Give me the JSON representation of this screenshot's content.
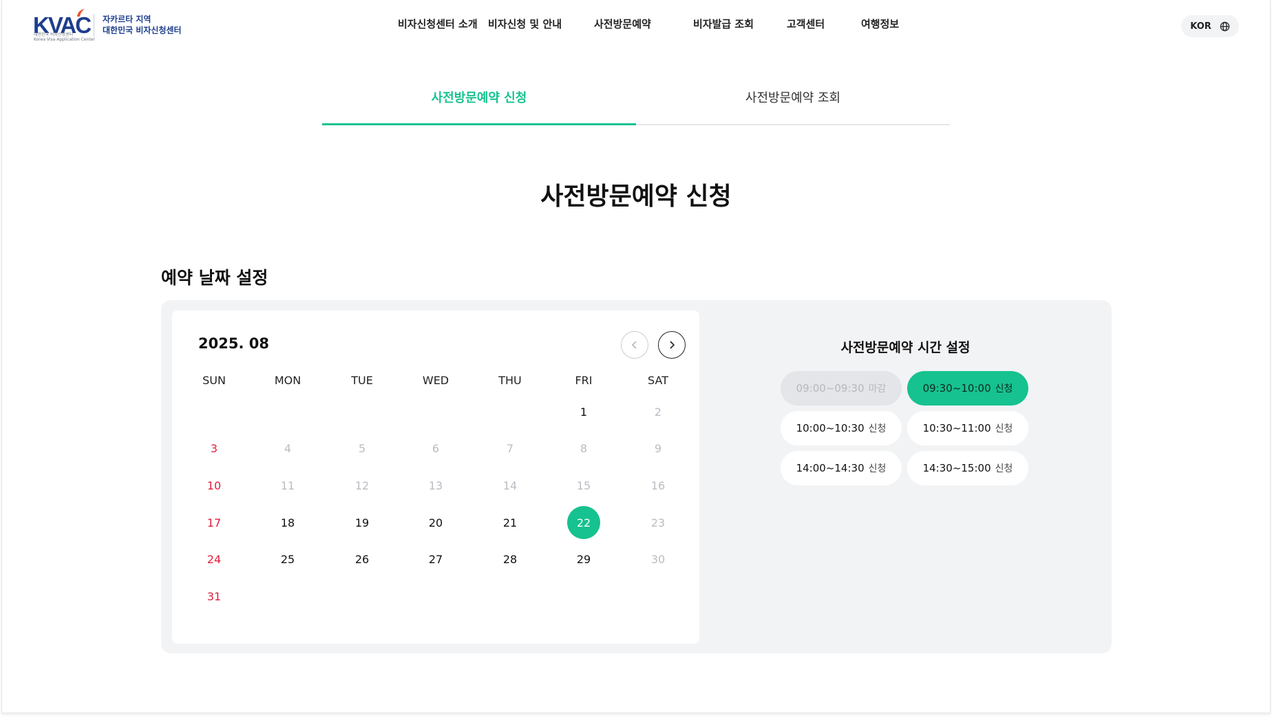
{
  "header": {
    "logo": {
      "brand": "KVAC",
      "tiny_line1": "대한민국 비자신청센터",
      "tiny_line2": "Korea Visa Application Center",
      "line1": "자카르타 지역",
      "line2": "대한민국 비자신청센터",
      "accent_color": "#e8542a",
      "brand_color": "#1d3e8c"
    },
    "nav": [
      {
        "label": "비자신청센터 소개"
      },
      {
        "label": "비자신청 및 안내"
      },
      {
        "label": "사전방문예약"
      },
      {
        "label": "비자발급 조회"
      },
      {
        "label": "고객센터"
      },
      {
        "label": "여행정보"
      }
    ],
    "lang": {
      "label": "KOR",
      "icon": "globe-icon"
    }
  },
  "tabs": [
    {
      "label": "사전방문예약 신청",
      "active": true
    },
    {
      "label": "사전방문예약 조회",
      "active": false
    }
  ],
  "page_title": "사전방문예약 신청",
  "section_title": "예약 날짜 설정",
  "calendar": {
    "month_label": "2025. 08",
    "prev_icon": "chevron-left-icon",
    "next_icon": "chevron-right-icon",
    "weekdays": [
      "SUN",
      "MON",
      "TUE",
      "WED",
      "THU",
      "FRI",
      "SAT"
    ],
    "first_weekday": 5,
    "days": [
      {
        "d": "1",
        "state": "avail"
      },
      {
        "d": "2",
        "state": "disabled"
      },
      {
        "d": "3",
        "state": "sunday"
      },
      {
        "d": "4",
        "state": "disabled"
      },
      {
        "d": "5",
        "state": "disabled"
      },
      {
        "d": "6",
        "state": "disabled"
      },
      {
        "d": "7",
        "state": "disabled"
      },
      {
        "d": "8",
        "state": "disabled"
      },
      {
        "d": "9",
        "state": "disabled"
      },
      {
        "d": "10",
        "state": "sunday"
      },
      {
        "d": "11",
        "state": "disabled"
      },
      {
        "d": "12",
        "state": "disabled"
      },
      {
        "d": "13",
        "state": "disabled"
      },
      {
        "d": "14",
        "state": "disabled"
      },
      {
        "d": "15",
        "state": "disabled"
      },
      {
        "d": "16",
        "state": "disabled"
      },
      {
        "d": "17",
        "state": "sunday"
      },
      {
        "d": "18",
        "state": "avail"
      },
      {
        "d": "19",
        "state": "avail"
      },
      {
        "d": "20",
        "state": "avail"
      },
      {
        "d": "21",
        "state": "avail"
      },
      {
        "d": "22",
        "state": "selected"
      },
      {
        "d": "23",
        "state": "disabled"
      },
      {
        "d": "24",
        "state": "sunday"
      },
      {
        "d": "25",
        "state": "avail"
      },
      {
        "d": "26",
        "state": "avail"
      },
      {
        "d": "27",
        "state": "avail"
      },
      {
        "d": "28",
        "state": "avail"
      },
      {
        "d": "29",
        "state": "avail"
      },
      {
        "d": "30",
        "state": "disabled"
      },
      {
        "d": "31",
        "state": "sunday"
      }
    ]
  },
  "time_panel": {
    "title": "사전방문예약 시간 설정",
    "slots": [
      {
        "time": "09:00~09:30",
        "suffix": "마감",
        "state": "closed"
      },
      {
        "time": "09:30~10:00",
        "suffix": "신청",
        "state": "selected"
      },
      {
        "time": "10:00~10:30",
        "suffix": "신청",
        "state": "open"
      },
      {
        "time": "10:30~11:00",
        "suffix": "신청",
        "state": "open"
      },
      {
        "time": "14:00~14:30",
        "suffix": "신청",
        "state": "open"
      },
      {
        "time": "14:30~15:00",
        "suffix": "신청",
        "state": "open"
      }
    ]
  },
  "colors": {
    "accent": "#16c28f",
    "sunday": "#e0203c",
    "disabled": "#b9bcc2",
    "panel_bg": "#f2f3f5"
  }
}
